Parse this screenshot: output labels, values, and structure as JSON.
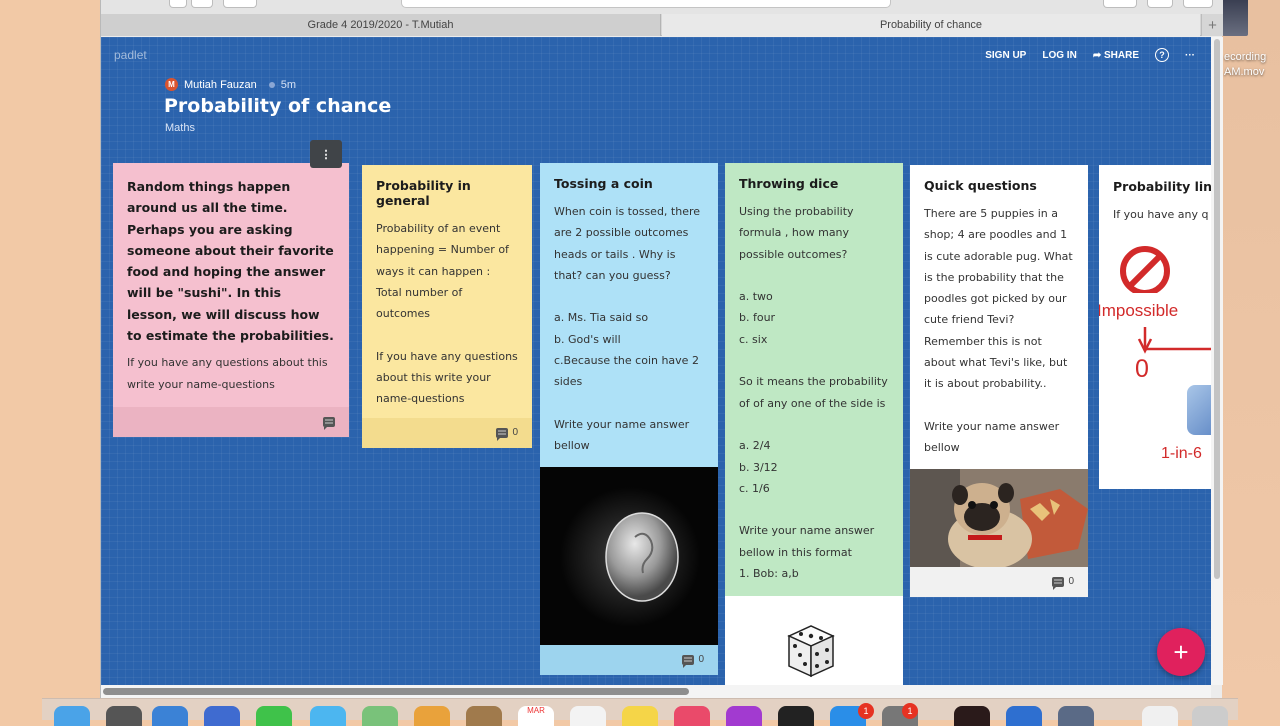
{
  "browser": {
    "tabs": [
      {
        "title": "Grade 4 2019/2020 - T.Mutiah",
        "active": false
      },
      {
        "title": "Probability of chance",
        "active": true
      }
    ],
    "new_tab_symbol": "+"
  },
  "desktop": {
    "file_label_line1": "ecording",
    "file_label_line2": "AM.mov"
  },
  "padlet": {
    "logo": "padlet",
    "nav": {
      "signup": "SIGN UP",
      "login": "LOG IN",
      "share": "SHARE",
      "help": "?",
      "more": "···"
    },
    "author": {
      "initial": "M",
      "name": "Mutiah Fauzan",
      "time": "5m"
    },
    "title": "Probability of chance",
    "subtitle": "Maths",
    "fab": "+"
  },
  "cards": [
    {
      "color": "#f5c0cf",
      "foot_color": "#ebb3c2",
      "title": "",
      "body": "Random things happen around us all the time. Perhaps you are asking someone about their favorite food and hoping the answer will be \"sushi\". In this lesson, we will discuss how to estimate the probabilities.",
      "body2": "If you have any questions about this write your name-questions",
      "comments": ""
    },
    {
      "color": "#fbe7a0",
      "foot_color": "#f3dc8e",
      "title": "Probability in general",
      "body": " Probability of an event happening = Number of ways it can happen : Total number of outcomes\n\nIf you have any questions about this write your name-questions",
      "comments": "0"
    },
    {
      "color": "#aee1f7",
      "foot_color": "#9dd4ee",
      "title": "Tossing a coin",
      "body": "When coin is tossed, there are 2 possible outcomes heads or tails . Why is that? can you guess?\n\na. Ms. Tia said so\nb. God's will\nc.Because the coin have 2 sides\n\nWrite your name answer bellow",
      "comments": "0"
    },
    {
      "color": "#bfe8c4",
      "foot_color": "#bfe8c4",
      "title": "Throwing dice",
      "body": "Using the probability formula , how many possible outcomes?\n\na. two\nb. four\nc. six\n\nSo it means the probability of of any one of the side is\n\na. 2/4\nb. 3/12\nc. 1/6\n\nWrite your name answer bellow in this format\n1. Bob: a,b",
      "comments": ""
    },
    {
      "color": "#ffffff",
      "foot_color": "#f1f1f1",
      "title": "Quick questions",
      "body": "There are 5 puppies in a shop; 4 are poodles and 1 is cute adorable pug. What is the probability that the poodles got picked by our cute friend Tevi? Remember this is not about what Tevi's like, but it is about probability..\n\nWrite your name answer bellow",
      "comments": "0"
    },
    {
      "color": "#ffffff",
      "foot_color": "#ffffff",
      "title": "Probability line",
      "body": "If you have any q",
      "image_labels": {
        "impossible": "Impossible",
        "zero": "0",
        "one_in_six": "1-in-6"
      },
      "comments": ""
    }
  ],
  "dock": {
    "badge1": "1",
    "badge2": "1",
    "calendar": "MAR"
  }
}
